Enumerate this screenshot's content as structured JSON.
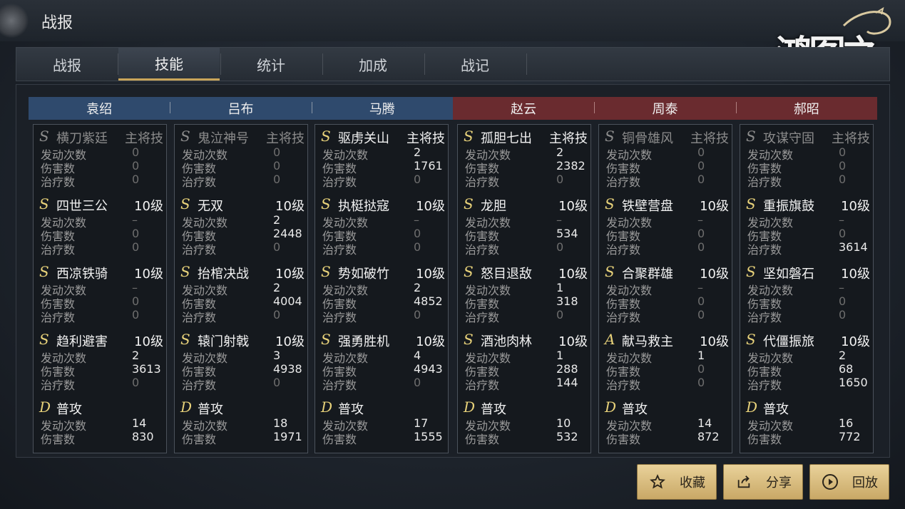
{
  "title": "战报",
  "logo_text": "鸿图之下",
  "tabs": [
    {
      "label": "战报"
    },
    {
      "label": "技能"
    },
    {
      "label": "统计"
    },
    {
      "label": "加成"
    },
    {
      "label": "战记"
    }
  ],
  "active_tab": "技能",
  "columns": [
    {
      "name": "袁绍",
      "side": "blue",
      "skills": [
        {
          "grade": "S",
          "name": "横刀紫廷",
          "level": "主将技",
          "dim": true,
          "stats": [
            [
              "发动次数",
              "0",
              true
            ],
            [
              "伤害数",
              "0",
              true
            ],
            [
              "治疗数",
              "0",
              true
            ]
          ]
        },
        {
          "grade": "S",
          "name": "四世三公",
          "level": "10级",
          "stats": [
            [
              "发动次数",
              "–",
              true
            ],
            [
              "伤害数",
              "0",
              true
            ],
            [
              "治疗数",
              "0",
              true
            ]
          ]
        },
        {
          "grade": "S",
          "name": "西凉铁骑",
          "level": "10级",
          "stats": [
            [
              "发动次数",
              "–",
              true
            ],
            [
              "伤害数",
              "0",
              true
            ],
            [
              "治疗数",
              "0",
              true
            ]
          ]
        },
        {
          "grade": "S",
          "name": "趋利避害",
          "level": "10级",
          "stats": [
            [
              "发动次数",
              "2",
              false
            ],
            [
              "伤害数",
              "3613",
              false
            ],
            [
              "治疗数",
              "0",
              true
            ]
          ]
        },
        {
          "grade": "D",
          "name": "普攻",
          "level": "",
          "stats": [
            [
              "发动次数",
              "14",
              false
            ],
            [
              "伤害数",
              "830",
              false
            ]
          ]
        }
      ]
    },
    {
      "name": "吕布",
      "side": "blue",
      "skills": [
        {
          "grade": "S",
          "name": "鬼泣神号",
          "level": "主将技",
          "dim": true,
          "stats": [
            [
              "发动次数",
              "0",
              true
            ],
            [
              "伤害数",
              "0",
              true
            ],
            [
              "治疗数",
              "0",
              true
            ]
          ]
        },
        {
          "grade": "S",
          "name": "无双",
          "level": "10级",
          "stats": [
            [
              "发动次数",
              "2",
              false
            ],
            [
              "伤害数",
              "2448",
              false
            ],
            [
              "治疗数",
              "0",
              true
            ]
          ]
        },
        {
          "grade": "S",
          "name": "抬棺决战",
          "level": "10级",
          "stats": [
            [
              "发动次数",
              "2",
              false
            ],
            [
              "伤害数",
              "4004",
              false
            ],
            [
              "治疗数",
              "0",
              true
            ]
          ]
        },
        {
          "grade": "S",
          "name": "辕门射戟",
          "level": "10级",
          "stats": [
            [
              "发动次数",
              "3",
              false
            ],
            [
              "伤害数",
              "4938",
              false
            ],
            [
              "治疗数",
              "0",
              true
            ]
          ]
        },
        {
          "grade": "D",
          "name": "普攻",
          "level": "",
          "stats": [
            [
              "发动次数",
              "18",
              false
            ],
            [
              "伤害数",
              "1971",
              false
            ]
          ]
        }
      ]
    },
    {
      "name": "马腾",
      "side": "blue",
      "skills": [
        {
          "grade": "S",
          "name": "驱虏关山",
          "level": "主将技",
          "stats": [
            [
              "发动次数",
              "2",
              false
            ],
            [
              "伤害数",
              "1761",
              false
            ],
            [
              "治疗数",
              "0",
              true
            ]
          ]
        },
        {
          "grade": "S",
          "name": "执梃挞寇",
          "level": "10级",
          "stats": [
            [
              "发动次数",
              "–",
              true
            ],
            [
              "伤害数",
              "0",
              true
            ],
            [
              "治疗数",
              "0",
              true
            ]
          ]
        },
        {
          "grade": "S",
          "name": "势如破竹",
          "level": "10级",
          "stats": [
            [
              "发动次数",
              "2",
              false
            ],
            [
              "伤害数",
              "4852",
              false
            ],
            [
              "治疗数",
              "0",
              true
            ]
          ]
        },
        {
          "grade": "S",
          "name": "强勇胜机",
          "level": "10级",
          "stats": [
            [
              "发动次数",
              "4",
              false
            ],
            [
              "伤害数",
              "4943",
              false
            ],
            [
              "治疗数",
              "0",
              true
            ]
          ]
        },
        {
          "grade": "D",
          "name": "普攻",
          "level": "",
          "stats": [
            [
              "发动次数",
              "17",
              false
            ],
            [
              "伤害数",
              "1555",
              false
            ]
          ]
        }
      ]
    },
    {
      "name": "赵云",
      "side": "red",
      "skills": [
        {
          "grade": "S",
          "name": "孤胆七出",
          "level": "主将技",
          "stats": [
            [
              "发动次数",
              "2",
              false
            ],
            [
              "伤害数",
              "2382",
              false
            ],
            [
              "治疗数",
              "0",
              true
            ]
          ]
        },
        {
          "grade": "S",
          "name": "龙胆",
          "level": "10级",
          "stats": [
            [
              "发动次数",
              "–",
              true
            ],
            [
              "伤害数",
              "534",
              false
            ],
            [
              "治疗数",
              "0",
              true
            ]
          ]
        },
        {
          "grade": "S",
          "name": "怒目退敌",
          "level": "10级",
          "stats": [
            [
              "发动次数",
              "1",
              false
            ],
            [
              "伤害数",
              "318",
              false
            ],
            [
              "治疗数",
              "0",
              true
            ]
          ]
        },
        {
          "grade": "S",
          "name": "酒池肉林",
          "level": "10级",
          "stats": [
            [
              "发动次数",
              "1",
              false
            ],
            [
              "伤害数",
              "288",
              false
            ],
            [
              "治疗数",
              "144",
              false
            ]
          ]
        },
        {
          "grade": "D",
          "name": "普攻",
          "level": "",
          "stats": [
            [
              "发动次数",
              "10",
              false
            ],
            [
              "伤害数",
              "532",
              false
            ]
          ]
        }
      ]
    },
    {
      "name": "周泰",
      "side": "red",
      "skills": [
        {
          "grade": "S",
          "name": "铜骨雄风",
          "level": "主将技",
          "dim": true,
          "stats": [
            [
              "发动次数",
              "0",
              true
            ],
            [
              "伤害数",
              "0",
              true
            ],
            [
              "治疗数",
              "0",
              true
            ]
          ]
        },
        {
          "grade": "S",
          "name": "铁壁营盘",
          "level": "10级",
          "stats": [
            [
              "发动次数",
              "–",
              true
            ],
            [
              "伤害数",
              "0",
              true
            ],
            [
              "治疗数",
              "0",
              true
            ]
          ]
        },
        {
          "grade": "S",
          "name": "合聚群雄",
          "level": "10级",
          "stats": [
            [
              "发动次数",
              "–",
              true
            ],
            [
              "伤害数",
              "0",
              true
            ],
            [
              "治疗数",
              "0",
              true
            ]
          ]
        },
        {
          "grade": "A",
          "name": "献马救主",
          "level": "10级",
          "stats": [
            [
              "发动次数",
              "1",
              false
            ],
            [
              "伤害数",
              "0",
              true
            ],
            [
              "治疗数",
              "0",
              true
            ]
          ]
        },
        {
          "grade": "D",
          "name": "普攻",
          "level": "",
          "stats": [
            [
              "发动次数",
              "14",
              false
            ],
            [
              "伤害数",
              "872",
              false
            ]
          ]
        }
      ]
    },
    {
      "name": "郝昭",
      "side": "red",
      "skills": [
        {
          "grade": "S",
          "name": "攻谋守固",
          "level": "主将技",
          "dim": true,
          "stats": [
            [
              "发动次数",
              "0",
              true
            ],
            [
              "伤害数",
              "0",
              true
            ],
            [
              "治疗数",
              "0",
              true
            ]
          ]
        },
        {
          "grade": "S",
          "name": "重振旗鼓",
          "level": "10级",
          "stats": [
            [
              "发动次数",
              "–",
              true
            ],
            [
              "伤害数",
              "0",
              true
            ],
            [
              "治疗数",
              "3614",
              false
            ]
          ]
        },
        {
          "grade": "S",
          "name": "坚如磐石",
          "level": "10级",
          "stats": [
            [
              "发动次数",
              "–",
              true
            ],
            [
              "伤害数",
              "0",
              true
            ],
            [
              "治疗数",
              "0",
              true
            ]
          ]
        },
        {
          "grade": "S",
          "name": "代僵振旅",
          "level": "10级",
          "stats": [
            [
              "发动次数",
              "2",
              false
            ],
            [
              "伤害数",
              "68",
              false
            ],
            [
              "治疗数",
              "1650",
              false
            ]
          ]
        },
        {
          "grade": "D",
          "name": "普攻",
          "level": "",
          "stats": [
            [
              "发动次数",
              "16",
              false
            ],
            [
              "伤害数",
              "772",
              false
            ]
          ]
        }
      ]
    }
  ],
  "buttons": {
    "favorite": "收藏",
    "share": "分享",
    "replay": "回放"
  },
  "icons": {
    "favorite": "star-icon",
    "share": "share-icon",
    "replay": "play-circle-icon"
  }
}
